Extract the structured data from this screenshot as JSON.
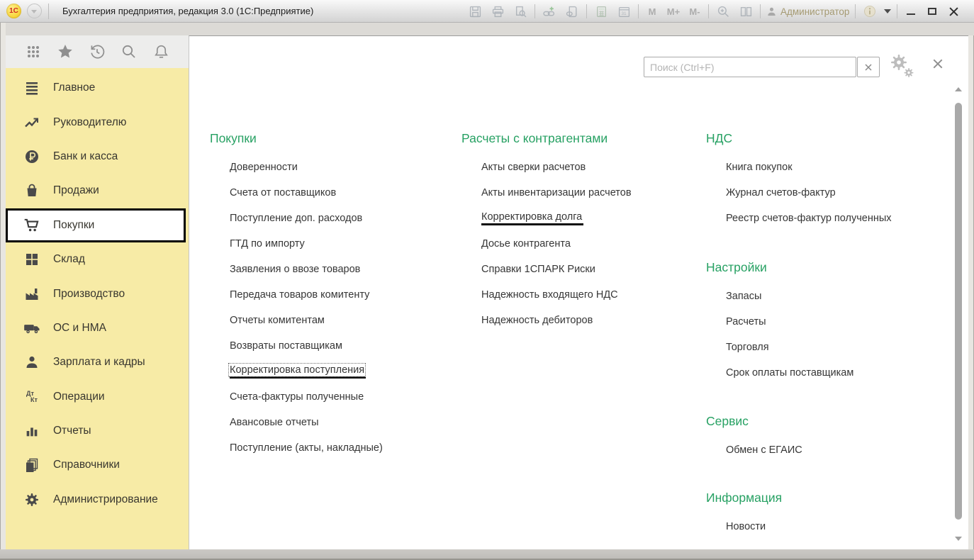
{
  "window": {
    "logo_text": "1С",
    "title": "Бухгалтерия предприятия, редакция 3.0  (1С:Предприятие)",
    "toolbar": {
      "m": "M",
      "m_plus": "M+",
      "m_minus": "M-",
      "calendar_label": "31",
      "user": "Администратор"
    }
  },
  "search": {
    "placeholder": "Поиск (Ctrl+F)"
  },
  "sidebar": {
    "dtkt": {
      "top": "Дт",
      "bottom": "Кт"
    },
    "items": [
      {
        "label": "Главное",
        "icon": "menu-lines-icon"
      },
      {
        "label": "Руководителю",
        "icon": "trend-icon"
      },
      {
        "label": "Банк и касса",
        "icon": "ruble-icon"
      },
      {
        "label": "Продажи",
        "icon": "bag-icon"
      },
      {
        "label": "Покупки",
        "icon": "cart-icon",
        "selected": true
      },
      {
        "label": "Склад",
        "icon": "warehouse-icon"
      },
      {
        "label": "Производство",
        "icon": "factory-icon"
      },
      {
        "label": "ОС и НМА",
        "icon": "truck-icon"
      },
      {
        "label": "Зарплата и кадры",
        "icon": "person-icon"
      },
      {
        "label": "Операции",
        "icon": "dtkt-icon"
      },
      {
        "label": "Отчеты",
        "icon": "barchart-icon"
      },
      {
        "label": "Справочники",
        "icon": "books-icon"
      },
      {
        "label": "Администрирование",
        "icon": "gear-icon"
      }
    ]
  },
  "menu": {
    "purchases": {
      "header": "Покупки",
      "items": [
        "Доверенности",
        "Счета от поставщиков",
        "Поступление доп. расходов",
        "ГТД по импорту",
        "Заявления о ввозе товаров",
        "Передача товаров комитенту",
        "Отчеты комитентам",
        "Возвраты поставщикам",
        "Корректировка поступления",
        "Счета-фактуры полученные",
        "Авансовые отчеты",
        "Поступление (акты, накладные)"
      ]
    },
    "settlements": {
      "header": "Расчеты с контрагентами",
      "items": [
        "Акты сверки расчетов",
        "Акты инвентаризации расчетов",
        "Корректировка долга",
        "Досье контрагента",
        "Справки 1СПАРК Риски",
        "Надежность входящего НДС",
        "Надежность дебиторов"
      ]
    },
    "vat": {
      "header": "НДС",
      "items": [
        "Книга покупок",
        "Журнал счетов-фактур",
        "Реестр счетов-фактур полученных"
      ]
    },
    "settings": {
      "header": "Настройки",
      "items": [
        "Запасы",
        "Расчеты",
        "Торговля",
        "Срок оплаты поставщикам"
      ]
    },
    "service": {
      "header": "Сервис",
      "items": [
        "Обмен с ЕГАИС"
      ]
    },
    "info": {
      "header": "Информация",
      "items": [
        "Новости"
      ]
    }
  },
  "colors": {
    "accent_green": "#27a163",
    "sidebar_yellow": "#f7eba6",
    "selected_border": "#000000"
  }
}
